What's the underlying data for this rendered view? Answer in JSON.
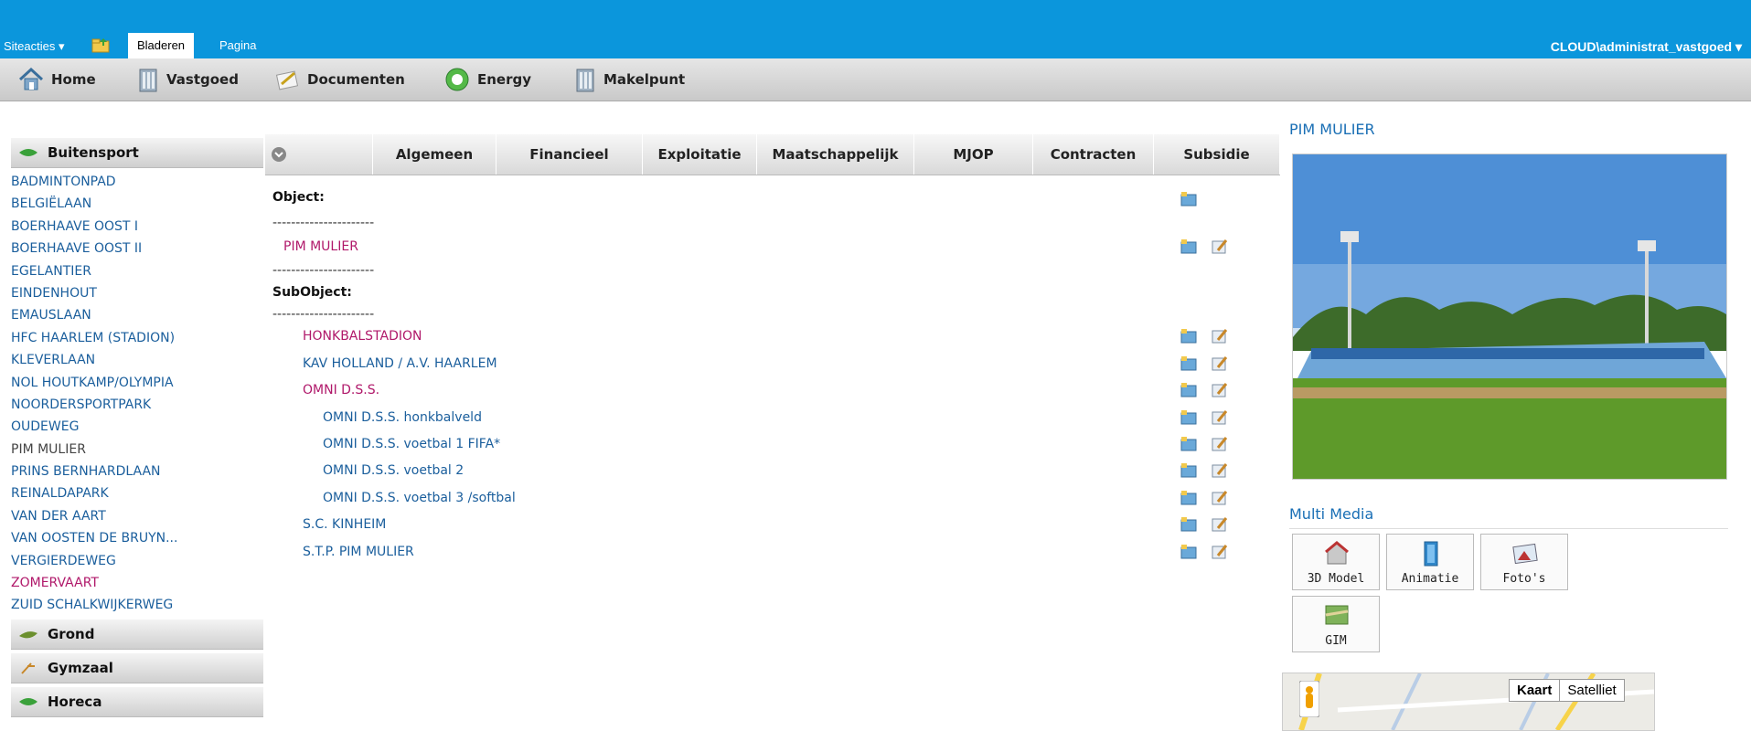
{
  "topbar": {
    "siteacties": "Siteacties ▾",
    "tabs": [
      "Bladeren",
      "Pagina"
    ],
    "user": "CLOUD\\administrat_vastgoed ▾"
  },
  "nav": [
    "Home",
    "Vastgoed",
    "Documenten",
    "Energy",
    "Makelpunt"
  ],
  "sidebar": {
    "sections": [
      "Buitensport",
      "Grond",
      "Gymzaal",
      "Horeca"
    ],
    "items": [
      "BADMINTONPAD",
      "BELGIËLAAN",
      "BOERHAAVE OOST I",
      "BOERHAAVE OOST II",
      "EGELANTIER",
      "EINDENHOUT",
      "EMAUSLAAN",
      "HFC HAARLEM (STADION)",
      "KLEVERLAAN",
      "NOL HOUTKAMP/OLYMPIA",
      "NOORDERSPORTPARK",
      "OUDEWEG",
      "PIM MULIER",
      "PRINS BERNHARDLAAN",
      "REINALDAPARK",
      "VAN DER AART",
      "VAN OOSTEN DE BRUYN...",
      "VERGIERDEWEG",
      "ZOMERVAART",
      "ZUID SCHALKWIJKERWEG"
    ],
    "current": "PIM MULIER",
    "visited": "ZOMERVAART"
  },
  "tabs": [
    "Algemeen",
    "Financieel",
    "Exploitatie",
    "Maatschappelijk",
    "MJOP",
    "Contracten",
    "Subsidie"
  ],
  "content": {
    "object_label": "Object:",
    "dashes": "----------------------",
    "object_name": "PIM MULIER",
    "subobject_label": "SubObject:",
    "subobjects": [
      "HONKBALSTADION",
      "KAV HOLLAND / A.V. HAARLEM",
      "OMNI D.S.S.",
      "OMNI D.S.S. honkbalveld",
      "OMNI D.S.S. voetbal 1 FIFA*",
      "OMNI D.S.S. voetbal 2",
      "OMNI D.S.S. voetbal 3 /softbal",
      "S.C. KINHEIM",
      "S.T.P. PIM MULIER"
    ]
  },
  "right": {
    "title": "PIM MULIER",
    "multimedia_title": "Multi Media",
    "media": [
      "3D Model",
      "Animatie",
      "Foto's",
      "GIM"
    ],
    "map_buttons": [
      "Kaart",
      "Satelliet"
    ]
  }
}
